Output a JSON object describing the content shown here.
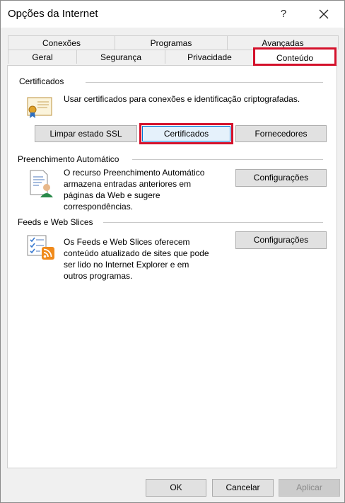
{
  "window": {
    "title": "Opções da Internet",
    "help_label": "?"
  },
  "tabs": {
    "back_row": [
      {
        "label": "Conexões"
      },
      {
        "label": "Programas"
      },
      {
        "label": "Avançadas"
      }
    ],
    "front_row": [
      {
        "label": "Geral"
      },
      {
        "label": "Segurança"
      },
      {
        "label": "Privacidade"
      },
      {
        "label": "Conteúdo"
      }
    ]
  },
  "certificates": {
    "title": "Certificados",
    "description": "Usar certificados para conexões e identificação criptografadas.",
    "buttons": {
      "clear_ssl": "Limpar estado SSL",
      "certificates": "Certificados",
      "publishers": "Fornecedores"
    }
  },
  "autocomplete": {
    "title": "Preenchimento Automático",
    "description_lines": [
      "O recurso Preenchimento Automático",
      "armazena entradas anteriores em",
      "páginas da Web e sugere",
      "correspondências."
    ],
    "settings_button": "Configurações"
  },
  "feeds": {
    "title": "Feeds e Web Slices",
    "description_lines": [
      "Os Feeds e Web Slices oferecem",
      "conteúdo atualizado de sites que pode",
      "ser lido no Internet Explorer e em",
      "outros programas."
    ],
    "settings_button": "Configurações"
  },
  "footer": {
    "ok": "OK",
    "cancel": "Cancelar",
    "apply": "Aplicar"
  },
  "colors": {
    "highlight": "#d4112b",
    "focus": "#0078d7"
  }
}
